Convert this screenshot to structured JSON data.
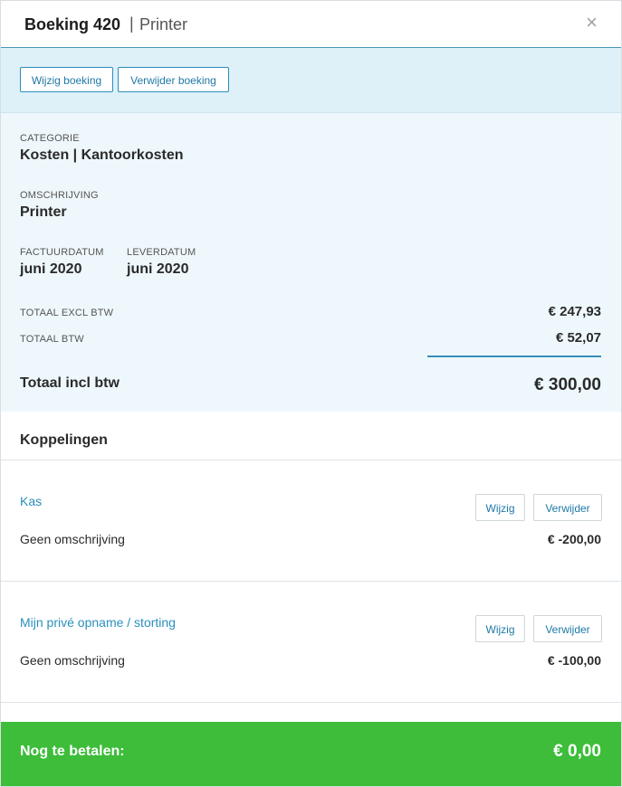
{
  "header": {
    "title": "Boeking 420",
    "separator": "|",
    "subtitle": "Printer",
    "close_icon": "×"
  },
  "actions": {
    "edit_label": "Wijzig boeking",
    "delete_label": "Verwijder boeking"
  },
  "details": {
    "category_label": "CATEGORIE",
    "category_value": "Kosten | Kantoorkosten",
    "description_label": "OMSCHRIJVING",
    "description_value": "Printer",
    "invoice_date_label": "FACTUURDATUM",
    "invoice_date_value": "juni 2020",
    "delivery_date_label": "LEVERDATUM",
    "delivery_date_value": "juni 2020",
    "total_excl_label": "TOTAAL EXCL BTW",
    "total_excl_value": "€ 247,93",
    "total_vat_label": "TOTAAL BTW",
    "total_vat_value": "€ 52,07",
    "total_incl_label": "Totaal incl btw",
    "total_incl_value": "€ 300,00"
  },
  "links": {
    "title": "Koppelingen",
    "items": [
      {
        "name": "Kas",
        "description": "Geen omschrijving",
        "amount": "€ -200,00",
        "edit_label": "Wijzig",
        "delete_label": "Verwijder"
      },
      {
        "name": "Mijn privé opname / storting",
        "description": "Geen omschrijving",
        "amount": "€ -100,00",
        "edit_label": "Wijzig",
        "delete_label": "Verwijder"
      }
    ]
  },
  "footer": {
    "label": "Nog te betalen:",
    "amount": "€ 0,00"
  },
  "colors": {
    "accent": "#2a8fbd",
    "action_bar_bg": "#def0f8",
    "details_bg": "#eef8fc",
    "footer_bg": "#3dbd3a"
  },
  "icons": {
    "close": "close-icon"
  }
}
